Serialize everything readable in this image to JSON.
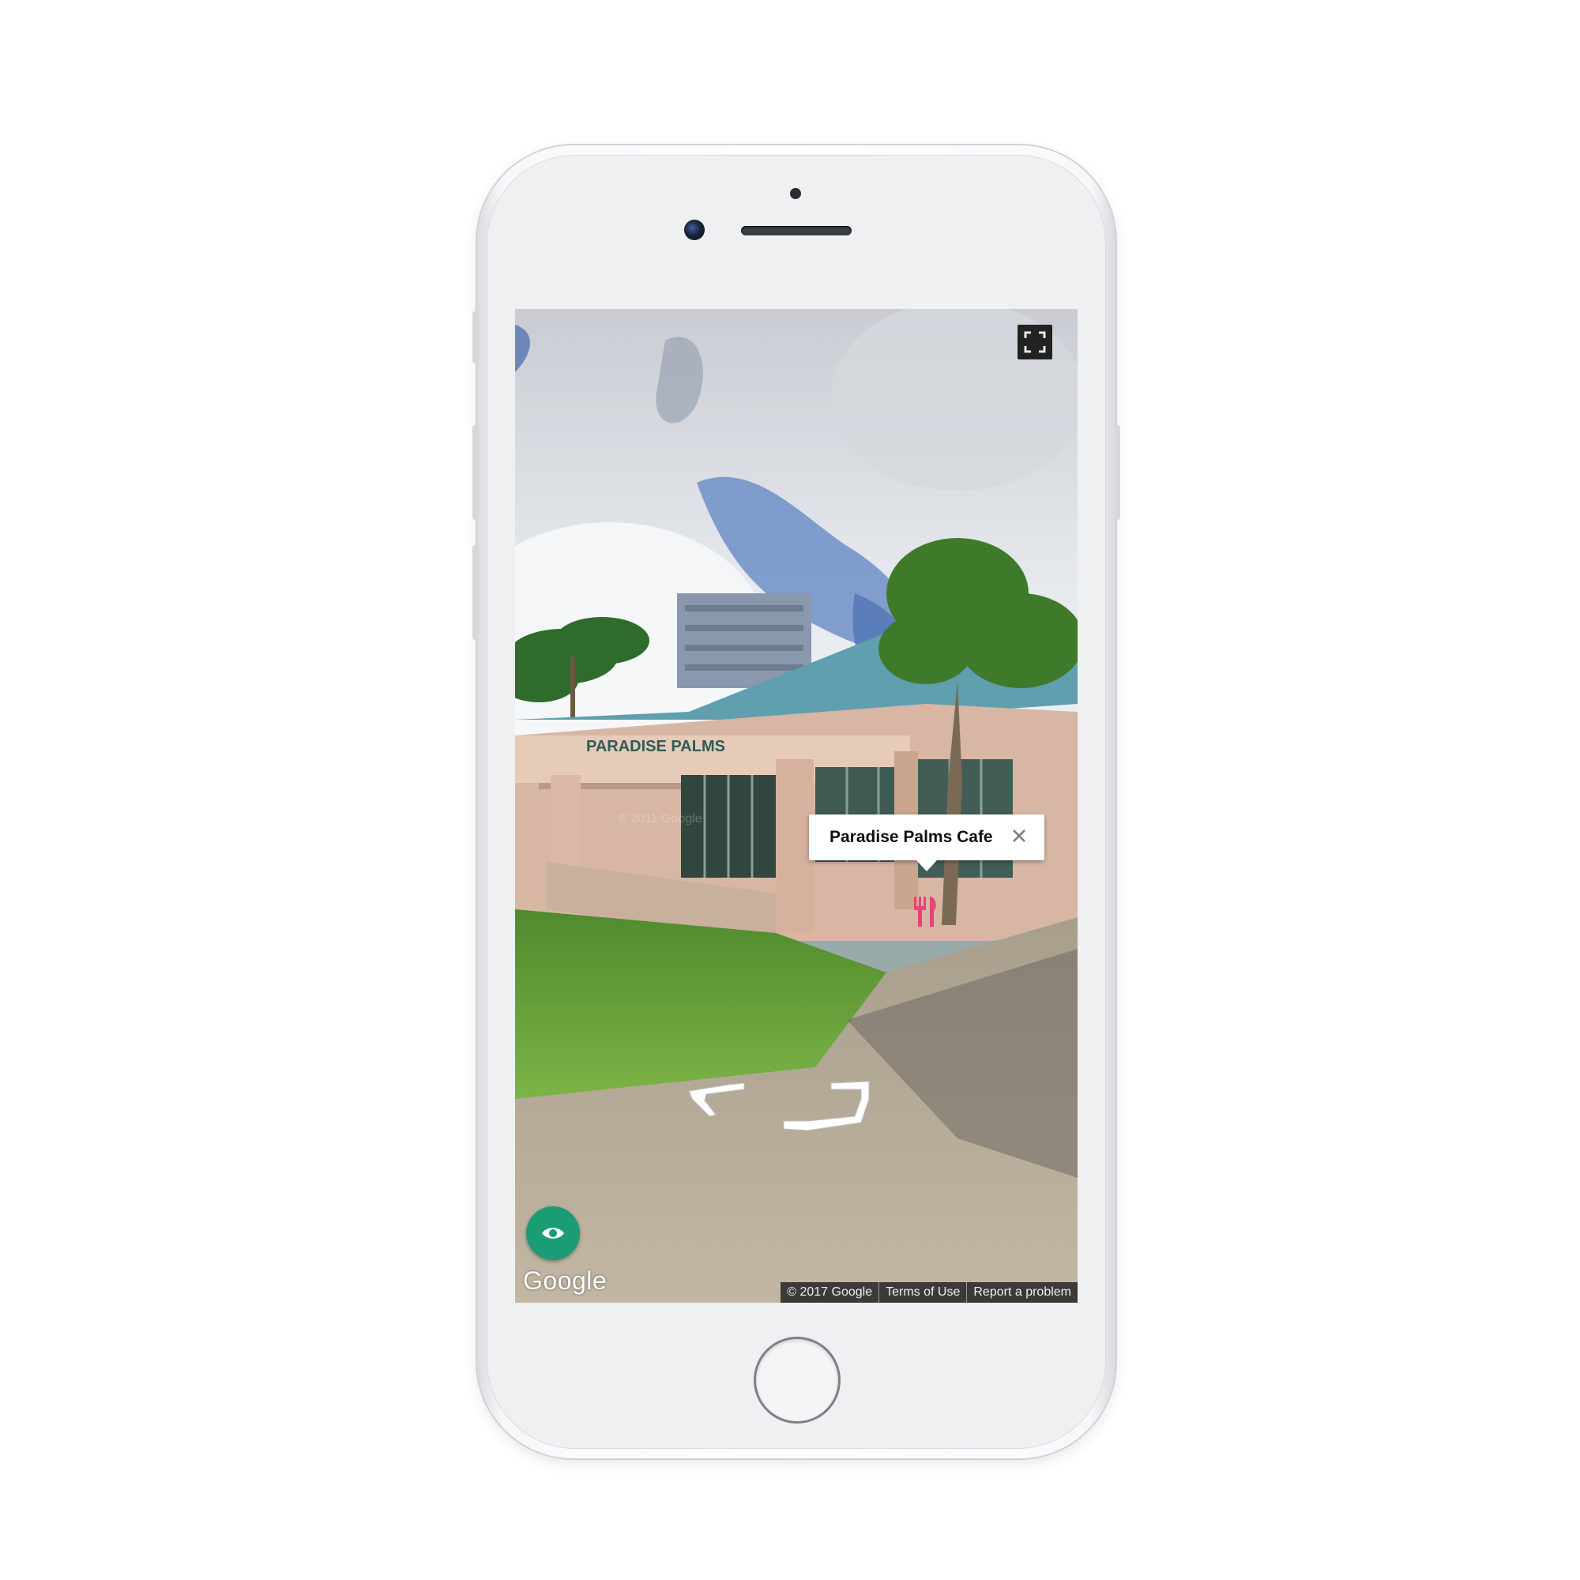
{
  "poi": {
    "title": "Paradise Palms Cafe"
  },
  "map_footer": {
    "logo": "Google",
    "copyright": "© 2017 Google",
    "terms": "Terms of Use",
    "report": "Report a problem"
  },
  "building_sign": "PARADISE PALMS",
  "watermark": "© 2011 Google",
  "colors": {
    "pegman_button": "#1a9c74",
    "poi_marker": "#e8437a",
    "fullscreen_button": "#222222"
  },
  "icons": {
    "fullscreen": "fullscreen-icon",
    "close": "close-icon",
    "marker": "restaurant-icon",
    "pegman": "eye-icon",
    "navigation": "navigation-arrows-icon"
  }
}
